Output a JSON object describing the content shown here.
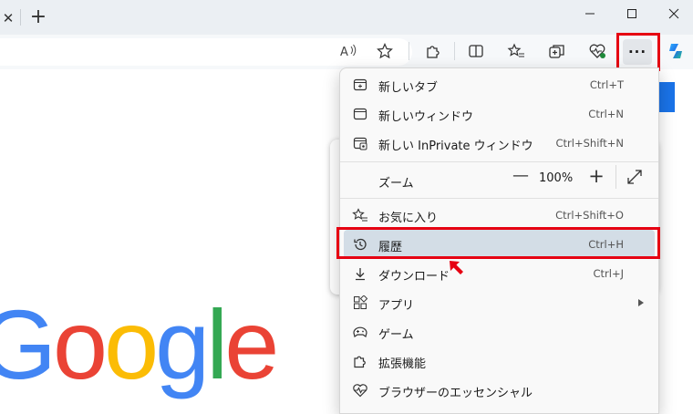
{
  "tabstrip": {
    "tab_close": "✕",
    "new_tab": "+"
  },
  "window": {
    "minimize": "—",
    "maximize": "☐",
    "close": "✕"
  },
  "toolbar": {
    "more_label": "···"
  },
  "menu": {
    "items": [
      {
        "label": "新しいタブ",
        "shortcut": "Ctrl+T",
        "icon": "new-tab-icon"
      },
      {
        "label": "新しいウィンドウ",
        "shortcut": "Ctrl+N",
        "icon": "new-window-icon"
      },
      {
        "label": "新しい InPrivate ウィンドウ",
        "shortcut": "Ctrl+Shift+N",
        "icon": "inprivate-icon"
      },
      {
        "label": "お気に入り",
        "shortcut": "Ctrl+Shift+O",
        "icon": "favorites-icon"
      },
      {
        "label": "履歴",
        "shortcut": "Ctrl+H",
        "icon": "history-icon"
      },
      {
        "label": "ダウンロード",
        "shortcut": "Ctrl+J",
        "icon": "download-icon"
      },
      {
        "label": "アプリ",
        "shortcut": "",
        "icon": "apps-icon"
      },
      {
        "label": "ゲーム",
        "shortcut": "",
        "icon": "games-icon"
      },
      {
        "label": "拡張機能",
        "shortcut": "",
        "icon": "extensions-icon"
      },
      {
        "label": "ブラウザーのエッセンシャル",
        "shortcut": "",
        "icon": "browser-essentials-icon"
      }
    ],
    "zoom": {
      "label": "ズーム",
      "value": "100%",
      "minus": "—",
      "plus": "+"
    }
  },
  "page": {
    "logo_letters": [
      "G",
      "o",
      "o",
      "g",
      "l",
      "e"
    ],
    "logo_colors": [
      "#4285F4",
      "#EA4335",
      "#FBBC05",
      "#4285F4",
      "#34A853",
      "#EA4335"
    ]
  },
  "colors": {
    "accent": "#1a73e8",
    "annotation": "#e60012",
    "highlight": "#d3dde6"
  }
}
